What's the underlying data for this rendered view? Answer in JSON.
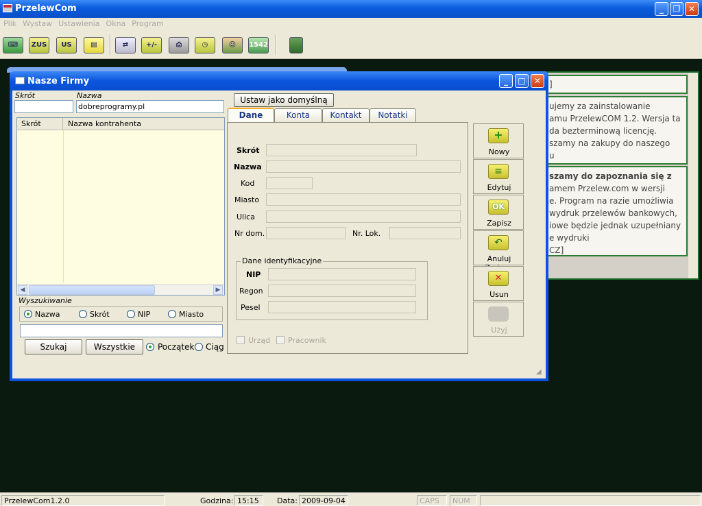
{
  "app": {
    "title": "PrzelewCom",
    "menu": [
      "Plik",
      "Wystaw",
      "Ustawienia",
      "Okna",
      "Program"
    ]
  },
  "toolbar": {
    "buttons": [
      "",
      "ZUS",
      "US",
      "",
      "",
      "+/-",
      "",
      "",
      "",
      "1542",
      ""
    ]
  },
  "background_window": {
    "lines_top": [
      "ujemy     za     zainstalowanie",
      "amu PrzelewCOM 1.2. Wersja ta",
      "da    bezterminową    licencję.",
      "szamy na zakupy do naszego",
      "u"
    ],
    "lines_bottom": [
      "szamy do zapoznania się z",
      "amem  Przelew.com  w  wersji",
      "e.  Program  na  razie  umożliwia",
      "wydruk przelewów bankowych,",
      "iowe będzie jednak uzupełniany",
      "e wydruki",
      "СZ]"
    ]
  },
  "dialog": {
    "title": "Nasze Firmy",
    "left": {
      "skrot_label": "Skrót",
      "nazwa_label": "Nazwa",
      "skrot_value": "",
      "nazwa_value": "dobreprogramy.pl",
      "col_skrot": "Skrót",
      "col_nazwa": "Nazwa kontrahenta",
      "search_label": "Wyszukiwanie",
      "radio_nazwa": "Nazwa",
      "radio_skrot": "Skrót",
      "radio_nip": "NIP",
      "radio_miasto": "Miasto",
      "search_value": "",
      "btn_szukaj": "Szukaj",
      "btn_wszystkie": "Wszystkie",
      "radio_poczatek": "Początek",
      "radio_ciag": "Ciąg"
    },
    "set_default": "Ustaw jako domyślną",
    "tabs": [
      "Dane",
      "Konta",
      "Kontakt",
      "Notatki"
    ],
    "form": {
      "skrot": "Skrót",
      "nazwa": "Nazwa",
      "kod": "Kod",
      "miasto": "Miasto",
      "ulica": "Ulica",
      "nr_dom": "Nr dom.",
      "nr_lok": "Nr. Lok.",
      "ident_group": "Dane identyfikacyjne",
      "nip": "NIP",
      "regon": "Regon",
      "pesel": "Pesel",
      "urzad": "Urząd",
      "pracownik": "Pracownik"
    },
    "side_buttons": {
      "nowy": "Nowy",
      "edytuj": "Edytuj",
      "zapisz": "Zapisz",
      "anuluj": "Anuluj Zmiany",
      "usun": "Usun",
      "uzyj": "Użyj",
      "ok_icon_text": "OK"
    }
  },
  "status": {
    "version": "PrzelewCom1.2.0",
    "godzina_label": "Godzina:",
    "godzina": "15:15",
    "data_label": "Data:",
    "data": "2009-09-04",
    "caps": "CAPS",
    "num": "NUM"
  },
  "colors": {
    "title_blue": "#0a5bdc",
    "panel": "#ece9d8",
    "list_bg": "#fefde2",
    "background": "#0a1a0e"
  }
}
